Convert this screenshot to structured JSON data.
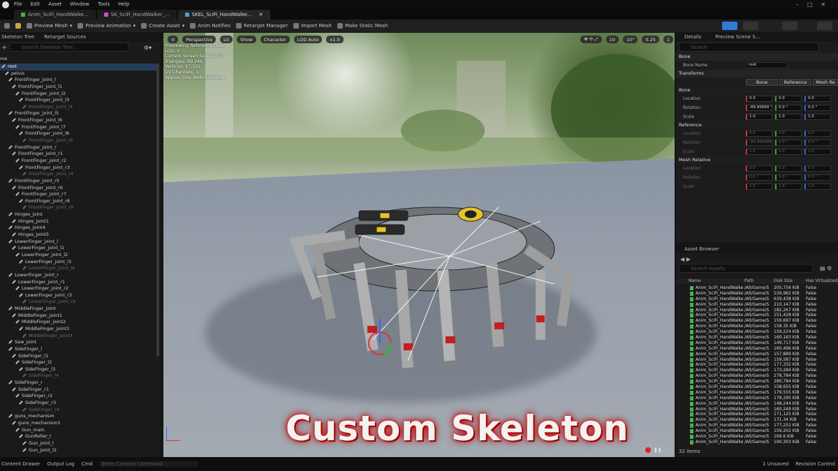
{
  "menu": [
    "File",
    "Edit",
    "Asset",
    "Window",
    "Tools",
    "Help"
  ],
  "tabs": [
    {
      "label": "Anim_SciFi_HandWalke...",
      "color": "#4caf50"
    },
    {
      "label": "SK_SciFi_HandWalker_...",
      "color": "#d04fd0"
    },
    {
      "label": "SKEL_SciFi_HandWalke...",
      "color": "#4aa3df"
    }
  ],
  "toolbar": [
    "Preview Mesh",
    "Preview Animation",
    "Create Asset",
    "Anim Notifies",
    "Retarget Manager",
    "Import Mesh",
    "Make Static Mesh"
  ],
  "left": {
    "tab1": "Skeleton Tree",
    "tab2": "Retarget Sources",
    "search_placeholder": "Search Skeleton Tree...",
    "col": "me"
  },
  "bones": [
    {
      "n": "root",
      "d": 0,
      "sel": true
    },
    {
      "n": "pelvis",
      "d": 1
    },
    {
      "n": "FrontFinger_joint_l",
      "d": 2
    },
    {
      "n": "FrontFinger_joint_l1",
      "d": 3
    },
    {
      "n": "FrontFinger_joint_l2",
      "d": 4
    },
    {
      "n": "FrontFinger_joint_l3",
      "d": 5
    },
    {
      "n": "FrontFinger_joint_l4",
      "d": 6,
      "dim": true
    },
    {
      "n": "FrontFinger_joint_l5",
      "d": 2
    },
    {
      "n": "FrontFinger_joint_l6",
      "d": 3
    },
    {
      "n": "FrontFinger_joint_l7",
      "d": 4
    },
    {
      "n": "FrontFinger_joint_l8",
      "d": 5
    },
    {
      "n": "FrontFinger_joint_l9",
      "d": 6,
      "dim": true
    },
    {
      "n": "FrontFinger_joint_r",
      "d": 2
    },
    {
      "n": "FrontFinger_joint_r1",
      "d": 3
    },
    {
      "n": "FrontFinger_joint_r2",
      "d": 4
    },
    {
      "n": "FrontFinger_joint_r3",
      "d": 5
    },
    {
      "n": "FrontFinger_joint_r4",
      "d": 6,
      "dim": true
    },
    {
      "n": "FrontFinger_joint_r5",
      "d": 2
    },
    {
      "n": "FrontFinger_joint_r6",
      "d": 3
    },
    {
      "n": "FrontFinger_joint_r7",
      "d": 4
    },
    {
      "n": "FrontFinger_joint_r8",
      "d": 5
    },
    {
      "n": "FrontFinger_joint_r9",
      "d": 6,
      "dim": true
    },
    {
      "n": "Hinges_joint",
      "d": 2
    },
    {
      "n": "Hinges_joint1",
      "d": 3
    },
    {
      "n": "Hinges_joint4",
      "d": 2
    },
    {
      "n": "Hinges_joint5",
      "d": 3
    },
    {
      "n": "LowerFinger_joint_l",
      "d": 2
    },
    {
      "n": "LowerFinger_joint_l1",
      "d": 3
    },
    {
      "n": "LowerFinger_joint_l2",
      "d": 4
    },
    {
      "n": "LowerFinger_joint_l3",
      "d": 5
    },
    {
      "n": "LowerFinger_joint_l4",
      "d": 6,
      "dim": true
    },
    {
      "n": "LowerFinger_joint_r",
      "d": 2
    },
    {
      "n": "LowerFinger_joint_r1",
      "d": 3
    },
    {
      "n": "LowerFinger_joint_r2",
      "d": 4
    },
    {
      "n": "LowerFinger_joint_r3",
      "d": 5
    },
    {
      "n": "LowerFinger_joint_r4",
      "d": 6,
      "dim": true
    },
    {
      "n": "MiddleFinger_joint",
      "d": 2
    },
    {
      "n": "MiddleFinger_joint1",
      "d": 3
    },
    {
      "n": "MiddleFinger_joint2",
      "d": 4
    },
    {
      "n": "MiddleFinger_joint3",
      "d": 5
    },
    {
      "n": "MiddleFinger_joint4",
      "d": 6,
      "dim": true
    },
    {
      "n": "Saw_joint",
      "d": 2
    },
    {
      "n": "SideFinger_l",
      "d": 2
    },
    {
      "n": "SideFinger_l1",
      "d": 3
    },
    {
      "n": "SideFinger_l2",
      "d": 4
    },
    {
      "n": "SideFinger_l3",
      "d": 5
    },
    {
      "n": "SideFinger_l4",
      "d": 6,
      "dim": true
    },
    {
      "n": "SideFinger_r",
      "d": 2
    },
    {
      "n": "SideFinger_r1",
      "d": 3
    },
    {
      "n": "SideFinger_r2",
      "d": 4
    },
    {
      "n": "SideFinger_r3",
      "d": 5
    },
    {
      "n": "SideFinger_r4",
      "d": 6,
      "dim": true
    },
    {
      "n": "guns_mechanism",
      "d": 2
    },
    {
      "n": "guns_mechanism1",
      "d": 3
    },
    {
      "n": "Gun_main",
      "d": 4
    },
    {
      "n": "GunRoller_l",
      "d": 5
    },
    {
      "n": "Gun_joint_l",
      "d": 6
    },
    {
      "n": "Gun_joint_l2",
      "d": 6
    }
  ],
  "viewport": {
    "buttons": [
      "Perspective",
      "Lit",
      "Show",
      "Character",
      "LOD Auto",
      "x1.0"
    ],
    "stats": [
      "Previewing Reference Pose",
      "LOD: 0",
      "Current Screen Size: 1.377",
      "Triangles: 89,246",
      "Vertices: 67,102",
      "UV Channels: 1",
      "Approx Size: 648x599x204"
    ],
    "right_vals": [
      "10",
      "10°",
      "0.25",
      "1"
    ],
    "overlay": "Custom Skeleton"
  },
  "details": {
    "tab1": "Details",
    "tab2": "Preview Scene S...",
    "search": "Search",
    "bone_section": "Bone",
    "bone_name_label": "Bone Name",
    "bone_name": "root",
    "transforms": "Transforms",
    "seg": [
      "Bone",
      "Reference",
      "Mesh Re"
    ],
    "groups": [
      {
        "name": "Bone",
        "rows": [
          {
            "l": "Location",
            "v": [
              "0.0",
              "0.0",
              "0.0"
            ]
          },
          {
            "l": "Rotation",
            "v": [
              "-89.99999 °",
              "0.0 °",
              "0.0 °"
            ]
          },
          {
            "l": "Scale",
            "v": [
              "1.0",
              "1.0",
              "1.0"
            ]
          }
        ]
      },
      {
        "name": "Reference",
        "rows": [
          {
            "l": "Location",
            "v": [
              "0.0",
              "0.0",
              "0.0"
            ]
          },
          {
            "l": "Rotation",
            "v": [
              "-89.999988 °",
              "0.0 °",
              "0.0 °"
            ]
          },
          {
            "l": "Scale",
            "v": [
              "1.0",
              "1.0",
              "1.0"
            ]
          }
        ],
        "dim": true
      },
      {
        "name": "Mesh Relative",
        "rows": [
          {
            "l": "Location",
            "v": [
              "0.0",
              "0.0",
              "0.0"
            ]
          },
          {
            "l": "Rotation",
            "v": [
              "0.0 °",
              "0.0 °",
              "0.0 °"
            ]
          },
          {
            "l": "Scale",
            "v": [
              "1.0",
              "1.0",
              "1.0"
            ]
          }
        ],
        "dim": true
      }
    ]
  },
  "assets": {
    "tab": "Asset Browser",
    "search": "Search Assets",
    "cols": [
      "Name",
      "Path",
      "Disk Size",
      "Has Virtualized"
    ],
    "count": "32 items",
    "rows": [
      [
        "Anim_SciFi_HandWalke",
        "/All/Game/S",
        "205,756 KiB",
        "False"
      ],
      [
        "Anim_SciFi_HandWalke",
        "/All/Game/S",
        "539,962 KiB",
        "False"
      ],
      [
        "Anim_SciFi_HandWalke",
        "/All/Game/S",
        "639,438 KiB",
        "False"
      ],
      [
        "Anim_SciFi_HandWalke",
        "/All/Game/S",
        "210,147 KiB",
        "False"
      ],
      [
        "Anim_SciFi_HandWalke",
        "/All/Game/S",
        "182,267 KiB",
        "False"
      ],
      [
        "Anim_SciFi_HandWalke",
        "/All/Game/S",
        "151,428 KiB",
        "False"
      ],
      [
        "Anim_SciFi_HandWalke",
        "/All/Game/S",
        "159,697 KiB",
        "False"
      ],
      [
        "Anim_SciFi_HandWalke",
        "/All/Game/S",
        "158.35 KiB",
        "False"
      ],
      [
        "Anim_SciFi_HandWalke",
        "/All/Game/S",
        "159,224 KiB",
        "False"
      ],
      [
        "Anim_SciFi_HandWalke",
        "/All/Game/S",
        "160,183 KiB",
        "False"
      ],
      [
        "Anim_SciFi_HandWalke",
        "/All/Game/S",
        "149,717 KiB",
        "False"
      ],
      [
        "Anim_SciFi_HandWalke",
        "/All/Game/S",
        "160,496 KiB",
        "False"
      ],
      [
        "Anim_SciFi_HandWalke",
        "/All/Game/S",
        "157,889 KiB",
        "False"
      ],
      [
        "Anim_SciFi_HandWalke",
        "/All/Game/S",
        "159,587 KiB",
        "False"
      ],
      [
        "Anim_SciFi_HandWalke",
        "/All/Game/S",
        "177,332 KiB",
        "False"
      ],
      [
        "Anim_SciFi_HandWalke",
        "/All/Game/S",
        "173,284 KiB",
        "False"
      ],
      [
        "Anim_SciFi_HandWalke",
        "/All/Game/S",
        "278,784 KiB",
        "False"
      ],
      [
        "Anim_SciFi_HandWalke",
        "/All/Game/S",
        "280,784 KiB",
        "False"
      ],
      [
        "Anim_SciFi_HandWalke",
        "/All/Game/S",
        "158,655 KiB",
        "False"
      ],
      [
        "Anim_SciFi_HandWalke",
        "/All/Game/S",
        "179,555 KiB",
        "False"
      ],
      [
        "Anim_SciFi_HandWalke",
        "/All/Game/S",
        "178,295 KiB",
        "False"
      ],
      [
        "Anim_SciFi_HandWalke",
        "/All/Game/S",
        "148,244 KiB",
        "False"
      ],
      [
        "Anim_SciFi_HandWalke",
        "/All/Game/S",
        "160,249 KiB",
        "False"
      ],
      [
        "Anim_SciFi_HandWalke",
        "/All/Game/S",
        "171,125 KiB",
        "False"
      ],
      [
        "Anim_SciFi_HandWalke",
        "/All/Game/S",
        "171.34 KiB",
        "False"
      ],
      [
        "Anim_SciFi_HandWalke",
        "/All/Game/S",
        "177,252 KiB",
        "False"
      ],
      [
        "Anim_SciFi_HandWalke",
        "/All/Game/S",
        "159,202 KiB",
        "False"
      ],
      [
        "Anim_SciFi_HandWalke",
        "/All/Game/S",
        "169.6 KiB",
        "False"
      ],
      [
        "Anim_SciFi_HandWalke",
        "/All/Game/S",
        "190,303 KiB",
        "False"
      ]
    ]
  },
  "status": {
    "content_drawer": "Content Drawer",
    "output_log": "Output Log",
    "cmd": "Cmd",
    "console_placeholder": "Enter Console Command",
    "unsaved": "1 Unsaved",
    "revision": "Revision Control"
  }
}
